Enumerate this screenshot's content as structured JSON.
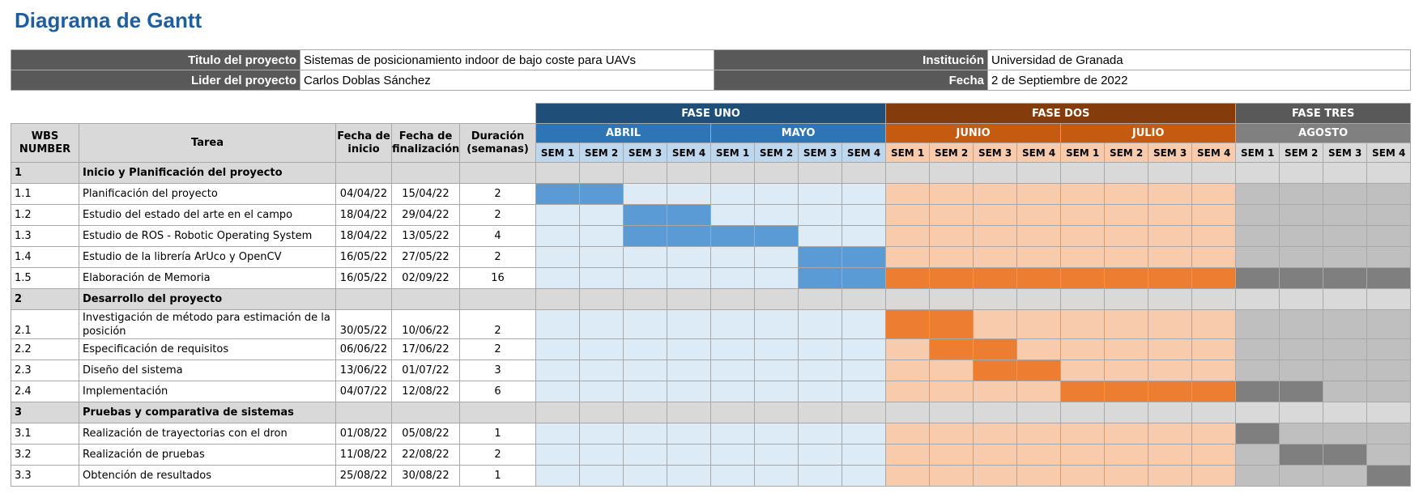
{
  "title": "Diagrama de Gantt",
  "info": {
    "project_title_label": "Titulo del proyecto",
    "project_title_value": "Sistemas de posicionamiento indoor de bajo coste para UAVs",
    "leader_label": "Lider del proyecto",
    "leader_value": "Carlos Doblas Sánchez",
    "institution_label": "Institución",
    "institution_value": "Universidad de Granada",
    "date_label": "Fecha",
    "date_value": "2 de Septiembre de 2022"
  },
  "headers": {
    "wbs": "WBS NUMBER",
    "task": "Tarea",
    "start": "Fecha de inicio",
    "end": "Fecha de finalización",
    "duration": "Duración (semanas)"
  },
  "phases": [
    {
      "label": "FASE UNO",
      "weeks": 8,
      "phase_color": "#1f4e79",
      "month_color": "#2e75b6",
      "week_color": "#bdd7ee",
      "empty": "#ddebf7",
      "bar": "#5b9bd5",
      "group_color": "#d9d9d9"
    },
    {
      "label": "FASE DOS",
      "weeks": 8,
      "phase_color": "#843c0c",
      "month_color": "#c55a11",
      "week_color": "#f8cbad",
      "empty": "#f8cbad",
      "bar": "#ed7d31",
      "group_color": "#d9d9d9"
    },
    {
      "label": "FASE TRES",
      "weeks": 4,
      "phase_color": "#595959",
      "month_color": "#808080",
      "week_color": "#d9d9d9",
      "empty": "#bfbfbf",
      "bar": "#7f7f7f",
      "group_color": "#d9d9d9"
    }
  ],
  "months": [
    {
      "label": "ABRIL",
      "weeks": 4,
      "phase": 0
    },
    {
      "label": "MAYO",
      "weeks": 4,
      "phase": 0
    },
    {
      "label": "JUNIO",
      "weeks": 4,
      "phase": 1
    },
    {
      "label": "JULIO",
      "weeks": 4,
      "phase": 1
    },
    {
      "label": "AGOSTO",
      "weeks": 4,
      "phase": 2
    }
  ],
  "week_labels": [
    "SEM 1",
    "SEM 2",
    "SEM 3",
    "SEM 4",
    "SEM 1",
    "SEM 2",
    "SEM 3",
    "SEM 4",
    "SEM 1",
    "SEM 2",
    "SEM 3",
    "SEM 4",
    "SEM 1",
    "SEM 2",
    "SEM 3",
    "SEM 4",
    "SEM 1",
    "SEM 2",
    "SEM 3",
    "SEM 4"
  ],
  "rows": [
    {
      "wbs": "1",
      "task": "Inicio y Planificación del proyecto",
      "start": "",
      "end": "",
      "duration": "",
      "group": true,
      "filled": []
    },
    {
      "wbs": "1.1",
      "task": "Planificación del proyecto",
      "start": "04/04/22",
      "end": "15/04/22",
      "duration": "2",
      "group": false,
      "filled": [
        0,
        1
      ]
    },
    {
      "wbs": "1.2",
      "task": "Estudio del estado del arte en el campo",
      "start": "18/04/22",
      "end": "29/04/22",
      "duration": "2",
      "group": false,
      "filled": [
        2,
        3
      ]
    },
    {
      "wbs": "1.3",
      "task": "Estudio de ROS - Robotic Operating System",
      "start": "18/04/22",
      "end": "13/05/22",
      "duration": "4",
      "group": false,
      "filled": [
        2,
        3,
        4,
        5
      ]
    },
    {
      "wbs": "1.4",
      "task": "Estudio de la librería ArUco y OpenCV",
      "start": "16/05/22",
      "end": "27/05/22",
      "duration": "2",
      "group": false,
      "filled": [
        6,
        7
      ]
    },
    {
      "wbs": "1.5",
      "task": "Elaboración de Memoria",
      "start": "16/05/22",
      "end": "02/09/22",
      "duration": "16",
      "group": false,
      "filled": [
        6,
        7,
        8,
        9,
        10,
        11,
        12,
        13,
        14,
        15,
        16,
        17,
        18,
        19
      ]
    },
    {
      "wbs": "2",
      "task": "Desarrollo del proyecto",
      "start": "",
      "end": "",
      "duration": "",
      "group": true,
      "filled": []
    },
    {
      "wbs": "2.1",
      "task": "Investigación de método para estimación de la posición",
      "start": "30/05/22",
      "end": "10/06/22",
      "duration": "2",
      "group": false,
      "tall": true,
      "filled": [
        8,
        9
      ]
    },
    {
      "wbs": "2.2",
      "task": "Especificación de requisitos",
      "start": "06/06/22",
      "end": "17/06/22",
      "duration": "2",
      "group": false,
      "filled": [
        9,
        10
      ]
    },
    {
      "wbs": "2.3",
      "task": "Diseño del sistema",
      "start": "13/06/22",
      "end": "01/07/22",
      "duration": "3",
      "group": false,
      "filled": [
        10,
        11
      ]
    },
    {
      "wbs": "2.4",
      "task": "Implementación",
      "start": "04/07/22",
      "end": "12/08/22",
      "duration": "6",
      "group": false,
      "filled": [
        12,
        13,
        14,
        15,
        16,
        17
      ]
    },
    {
      "wbs": "3",
      "task": "Pruebas y comparativa de sistemas",
      "start": "",
      "end": "",
      "duration": "",
      "group": true,
      "filled": []
    },
    {
      "wbs": "3.1",
      "task": "Realización de trayectorias con el dron",
      "start": "01/08/22",
      "end": "05/08/22",
      "duration": "1",
      "group": false,
      "filled": [
        16
      ]
    },
    {
      "wbs": "3.2",
      "task": "Realización de pruebas",
      "start": "11/08/22",
      "end": "22/08/22",
      "duration": "2",
      "group": false,
      "filled": [
        17,
        18
      ]
    },
    {
      "wbs": "3.3",
      "task": "Obtención de resultados",
      "start": "25/08/22",
      "end": "30/08/22",
      "duration": "1",
      "group": false,
      "filled": [
        19
      ]
    }
  ]
}
